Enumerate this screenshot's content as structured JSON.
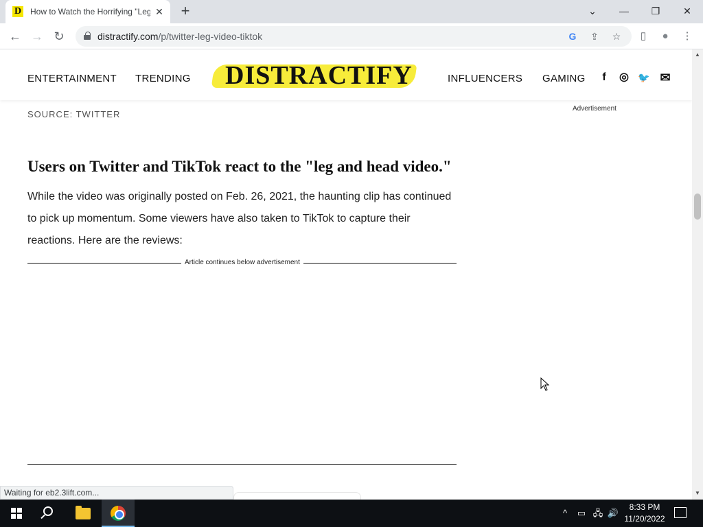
{
  "browser": {
    "tab": {
      "favicon": "D",
      "title": "How to Watch the Horrifying \"Leg and Head Video\"",
      "close": "✕"
    },
    "new_tab": "+",
    "window_controls": {
      "tabsearch": "⌄",
      "minimize": "—",
      "restore": "❐",
      "close": "✕"
    },
    "nav": {
      "back": "←",
      "forward": "→",
      "reload": "↻"
    },
    "url_domain": "distractify.com",
    "url_path": "/p/twitter-leg-video-tiktok",
    "omnibox_icons": {
      "google": "G",
      "share": "⇪",
      "bookmark": "☆"
    },
    "toolbar_icons": {
      "sidepanel": "▯",
      "profile": "●",
      "menu": "⋮"
    }
  },
  "site": {
    "nav_left": [
      "ENTERTAINMENT",
      "TRENDING"
    ],
    "logo": "DISTRACTIFY",
    "nav_right": [
      "INFLUENCERS",
      "GAMING"
    ],
    "social": {
      "facebook": "f",
      "instagram": "◎",
      "twitter": "🐦",
      "email": "✉"
    }
  },
  "article": {
    "source": "SOURCE: TWITTER",
    "heading": "Users on Twitter and TikTok react to the \"leg and head video.\"",
    "paragraph": "While the video was originally posted on Feb. 26, 2021, the haunting clip has continued to pick up momentum. Some viewers have also taken to TikTok to capture their reactions. Here are the reviews:",
    "ad_divider_label": "Article continues below advertisement",
    "sidebar_ad_label": "Advertisement"
  },
  "status_text": "Waiting for eb2.3lift.com...",
  "taskbar": {
    "time": "8:33 PM",
    "date": "11/20/2022",
    "tray": {
      "chevron": "^",
      "network": "🖧",
      "volume": "🔊",
      "battery": "▭"
    }
  }
}
